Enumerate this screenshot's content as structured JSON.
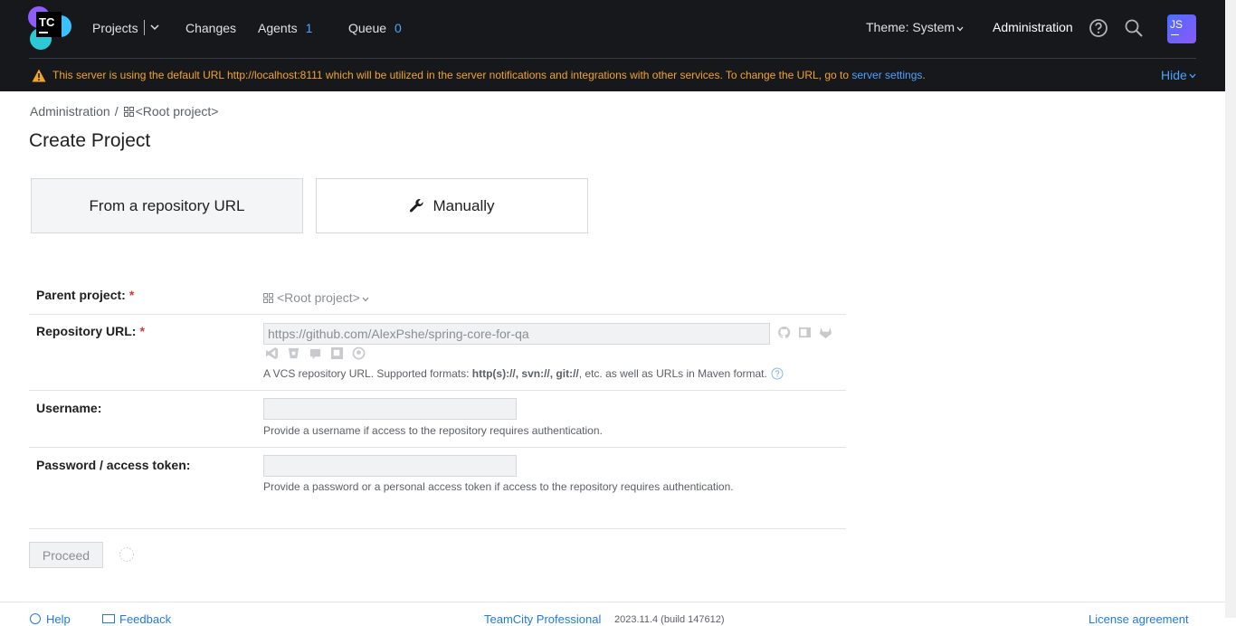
{
  "header": {
    "logo_text": "TC",
    "nav": {
      "projects": "Projects",
      "changes": "Changes",
      "agents": "Agents",
      "agents_count": "1",
      "queue": "Queue",
      "queue_count": "0"
    },
    "theme_label": "Theme: System",
    "administration": "Administration",
    "avatar_initials": "JS"
  },
  "warning": {
    "text": "This server is using the default URL http://localhost:8111 which will be utilized in the server notifications and integrations with other services. To change the URL, go to ",
    "link": "server settings",
    "suffix": ".",
    "hide": "Hide"
  },
  "breadcrumb": {
    "admin": "Administration",
    "separator": "/",
    "root": "<Root project>"
  },
  "page_title": "Create Project",
  "modes": {
    "from_url": "From a repository URL",
    "manually": "Manually"
  },
  "form": {
    "parent_label": "Parent project:",
    "parent_value": "<Root project>",
    "repo_label": "Repository URL:",
    "repo_value": "https://github.com/AlexPshe/spring-core-for-qa",
    "repo_hint_prefix": "A VCS repository URL. Supported formats: ",
    "repo_hint_formats": "http(s)://, svn://, git://",
    "repo_hint_suffix": ", etc. as well as URLs in Maven format.",
    "username_label": "Username:",
    "username_value": "",
    "username_hint": "Provide a username if access to the repository requires authentication.",
    "password_label": "Password / access token:",
    "password_value": "",
    "password_hint": "Provide a password or a personal access token if access to the repository requires authentication.",
    "required_mark": "*",
    "proceed": "Proceed"
  },
  "footer": {
    "help": "Help",
    "feedback": "Feedback",
    "product": "TeamCity Professional",
    "version": "2023.11.4 (build 147612)",
    "license": "License agreement"
  },
  "colors": {
    "header_bg": "#17181b",
    "warning": "#f0a430",
    "link": "#4da3ff",
    "required": "#e03535"
  }
}
